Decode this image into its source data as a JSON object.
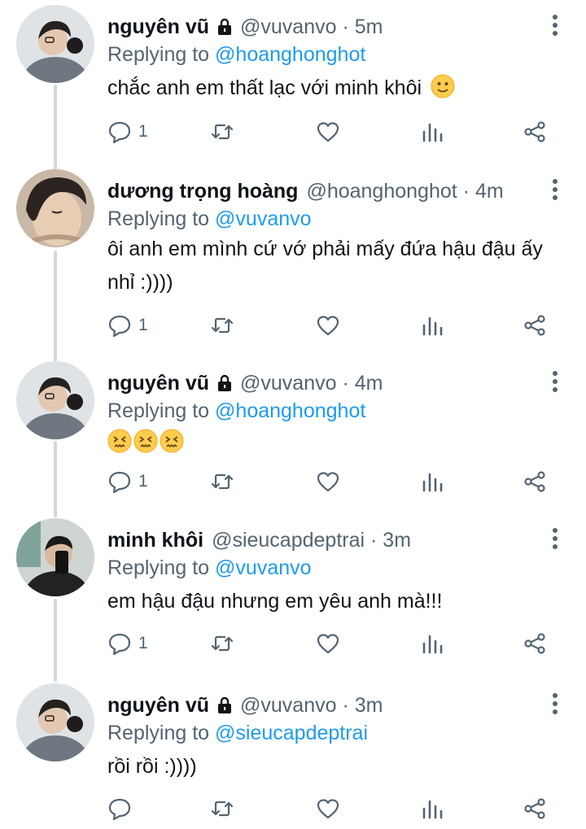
{
  "colors": {
    "text": "#0f1419",
    "muted": "#536471",
    "link": "#1d9bf0",
    "thread_line": "#cfd9de"
  },
  "icons": [
    "lock-icon",
    "more-icon",
    "reply-icon",
    "retweet-icon",
    "like-icon",
    "stats-icon",
    "share-icon"
  ],
  "tweets": [
    {
      "name": "nguyên vũ",
      "locked": true,
      "handle": "@vuvanvo",
      "sep": "·",
      "time": "5m",
      "replying_prefix": "Replying to ",
      "replying_to": "@hoanghonghot",
      "text": "chắc anh em thất lạc với minh khôi",
      "emoji": "slightly-smiling-face",
      "reply_count": "1"
    },
    {
      "name": "dương trọng hoàng",
      "locked": false,
      "handle": "@hoanghonghot",
      "sep": "·",
      "time": "4m",
      "replying_prefix": "Replying to ",
      "replying_to": "@vuvanvo",
      "text": "ôi anh em mình cứ vớ phải mấy đứa hậu đậu ấy nhỉ :))))",
      "reply_count": "1"
    },
    {
      "name": "nguyên vũ",
      "locked": true,
      "handle": "@vuvanvo",
      "sep": "·",
      "time": "4m",
      "replying_prefix": "Replying to ",
      "replying_to": "@hoanghonghot",
      "text": "",
      "emoji": "confounded-face x3",
      "reply_count": "1"
    },
    {
      "name": "minh khôi",
      "locked": false,
      "handle": "@sieucapdeptrai",
      "sep": "·",
      "time": "3m",
      "replying_prefix": "Replying to ",
      "replying_to": "@vuvanvo",
      "text": "em hậu đậu nhưng em yêu anh mà!!!",
      "reply_count": "1"
    },
    {
      "name": "nguyên vũ",
      "locked": true,
      "handle": "@vuvanvo",
      "sep": "·",
      "time": "3m",
      "replying_prefix": "Replying to ",
      "replying_to": "@sieucapdeptrai",
      "text": "rồi rồi :))))",
      "reply_count": ""
    }
  ]
}
